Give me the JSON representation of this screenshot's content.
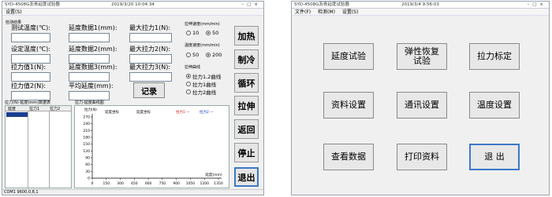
{
  "w1": {
    "title": "SYD-4508G沥青延度试验器",
    "datetime": "2019/3/20 10:04:34",
    "menu": [
      "设置(S)"
    ],
    "group_params": "检测结果",
    "params": [
      "测试温度(℃):",
      "设定温度(℃):",
      "拉力值1(N):",
      "拉力值2(N):"
    ],
    "ductility": [
      "延度数据1(mm):",
      "延度数据2(mm):",
      "延度数据3(mm):",
      "平均延度(mm):"
    ],
    "max_force": [
      "最大拉力1(N):",
      "最大拉力2(N):",
      "最大拉力3(N):"
    ],
    "speed_label": "拉伸速度(mm/min)",
    "speed_options": [
      "10",
      "50"
    ],
    "speed_selected": 1,
    "temp_label": "温度速度(mm/min)",
    "temp_options": [
      "50",
      "200"
    ],
    "temp_selected": 1,
    "curve_label": "拉伸曲线",
    "curve_options": [
      "拉力1,2曲线",
      "拉力1曲线",
      "拉力2曲线"
    ],
    "curve_selected": 0,
    "record_button": "记录",
    "side_buttons": [
      "加热",
      "制冷",
      "循环",
      "拉伸",
      "返回",
      "停止",
      "退出"
    ],
    "table_title": "拉力(N)-延度(mm)数据表",
    "table_headers": [
      "延度",
      "拉力1",
      "拉力2"
    ],
    "chart_title": "拉力-延度曲线图",
    "chart_ylabel": "拉力(N)",
    "chart_legend": [
      "延度坐标",
      "拉力1",
      "拉力2"
    ],
    "chart_xlabel": "延度(mm)",
    "status": "COM1 9600,0,8,1"
  },
  "w2": {
    "title": "SYD-4508G沥青延度试验器",
    "datetime": "2019/3/4 9:56:03",
    "menu": [
      "文件(F)",
      "检测(M)",
      "设置(S)"
    ],
    "buttons": [
      "延度试验",
      "弹性恢复\n试验",
      "拉力标定",
      "资料设置",
      "通讯设置",
      "温度设置",
      "查看数据",
      "打印资料",
      "退 出"
    ]
  },
  "chart_data": {
    "type": "line",
    "title": "拉力-延度曲线图",
    "xlabel": "延度(mm)",
    "ylabel": "拉力(N)",
    "xticks": [
      0,
      150,
      300,
      450,
      600,
      750,
      900,
      1050,
      1200,
      1350
    ],
    "yticks": [
      0,
      30,
      60,
      90,
      120,
      150,
      180,
      210,
      240,
      270
    ],
    "xlim": [
      0,
      1350
    ],
    "ylim": [
      0,
      270
    ],
    "series": [
      {
        "name": "拉力1",
        "values": []
      },
      {
        "name": "拉力2",
        "values": []
      }
    ],
    "colors": {
      "拉力1": "#d01010",
      "拉力2": "#1030d0"
    }
  }
}
